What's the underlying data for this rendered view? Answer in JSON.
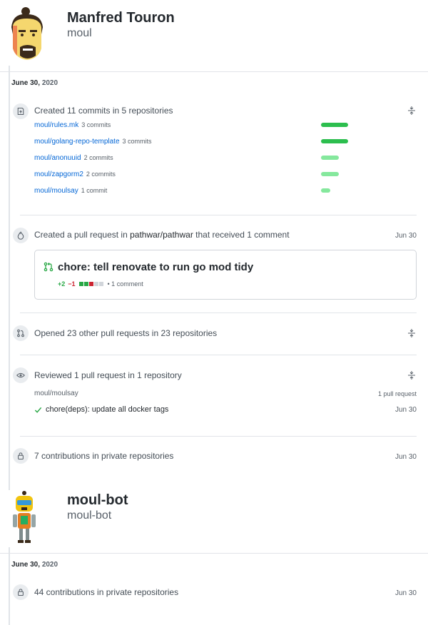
{
  "profile1": {
    "name": "Manfred Touron",
    "login": "moul"
  },
  "section1": {
    "date": "June 30,",
    "year": "2020",
    "commits": {
      "title": "Created 11 commits in 5 repositories",
      "repos": [
        {
          "name": "moul/rules.mk",
          "count": "3 commits",
          "fraction": 1.0
        },
        {
          "name": "moul/golang-repo-template",
          "count": "3 commits",
          "fraction": 1.0
        },
        {
          "name": "moul/anonuuid",
          "count": "2 commits",
          "fraction": 0.67
        },
        {
          "name": "moul/zapgorm2",
          "count": "2 commits",
          "fraction": 0.67
        },
        {
          "name": "moul/moulsay",
          "count": "1 commit",
          "fraction": 0.33
        }
      ]
    },
    "pr_created": {
      "prefix": "Created a pull request in",
      "repo": "pathwar/pathwar",
      "suffix": "that received 1 comment",
      "date": "Jun 30",
      "card": {
        "title": "chore: tell renovate to run go mod tidy",
        "additions": "+2",
        "deletions": "−1",
        "comments": "• 1 comment"
      }
    },
    "pr_opened": {
      "title": "Opened 23 other pull requests in 23 repositories"
    },
    "reviewed": {
      "title": "Reviewed 1 pull request in 1 repository",
      "repo": "moul/moulsay",
      "count": "1 pull request",
      "item": "chore(deps): update all docker tags",
      "date": "Jun 30"
    },
    "private": {
      "title": "7 contributions in private repositories",
      "date": "Jun 30"
    }
  },
  "profile2": {
    "name": "moul-bot",
    "login": "moul-bot"
  },
  "section2": {
    "date": "June 30,",
    "year": "2020",
    "private": {
      "title": "44 contributions in private repositories",
      "date": "Jun 30"
    }
  },
  "colors": {
    "bar_full": "#2cbe4e",
    "bar_light": "#85e89d",
    "link": "#0366d6",
    "add": "#28a745",
    "del": "#cb2431"
  }
}
